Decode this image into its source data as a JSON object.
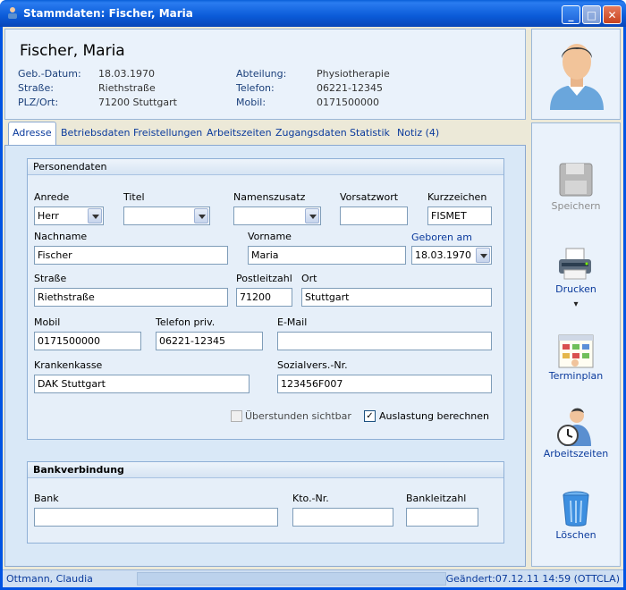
{
  "window": {
    "title": "Stammdaten: Fischer, Maria"
  },
  "header": {
    "name": "Fischer, Maria",
    "fields": [
      {
        "label": "Geb.-Datum:",
        "value": "18.03.1970"
      },
      {
        "label": "Straße:",
        "value": "Riethstraße"
      },
      {
        "label": "PLZ/Ort:",
        "value": "71200 Stuttgart"
      },
      {
        "label": "Abteilung:",
        "value": "Physiotherapie"
      },
      {
        "label": "Telefon:",
        "value": "06221-12345"
      },
      {
        "label": "Mobil:",
        "value": "0171500000"
      }
    ]
  },
  "tabs": [
    "Adresse",
    "Betriebsdaten",
    "Freistellungen",
    "Arbeitszeiten",
    "Zugangsdaten",
    "Statistik",
    "Notiz (4)"
  ],
  "personendaten": {
    "title": "Personendaten",
    "anrede": {
      "label": "Anrede",
      "value": "Herr"
    },
    "titel": {
      "label": "Titel",
      "value": ""
    },
    "namenszusatz": {
      "label": "Namenszusatz",
      "value": ""
    },
    "vorsatzwort": {
      "label": "Vorsatzwort",
      "value": ""
    },
    "kurzzeichen": {
      "label": "Kurzzeichen",
      "value": "FISMET"
    },
    "nachname": {
      "label": "Nachname",
      "value": "Fischer"
    },
    "vorname": {
      "label": "Vorname",
      "value": "Maria"
    },
    "geboren": {
      "label": "Geboren am",
      "value": "18.03.1970"
    },
    "strasse": {
      "label": "Straße",
      "value": "Riethstraße"
    },
    "plz": {
      "label": "Postleitzahl",
      "value": "71200"
    },
    "ort": {
      "label": "Ort",
      "value": "Stuttgart"
    },
    "mobil": {
      "label": "Mobil",
      "value": "0171500000"
    },
    "telefon": {
      "label": "Telefon priv.",
      "value": "06221-12345"
    },
    "email": {
      "label": "E-Mail",
      "value": ""
    },
    "krankenkasse": {
      "label": "Krankenkasse",
      "value": "DAK Stuttgart"
    },
    "sozial": {
      "label": "Sozialvers.-Nr.",
      "value": "123456F007"
    },
    "ueberstunden": {
      "label": "Überstunden sichtbar",
      "checked": false
    },
    "auslastung": {
      "label": "Auslastung berechnen",
      "checked": true,
      "mark": "✓"
    }
  },
  "bank": {
    "title": "Bankverbindung",
    "bank": {
      "label": "Bank",
      "value": ""
    },
    "kto": {
      "label": "Kto.-Nr.",
      "value": ""
    },
    "blz": {
      "label": "Bankleitzahl",
      "value": ""
    }
  },
  "sidebar": {
    "speichern": "Speichern",
    "drucken": "Drucken",
    "drucken_arrow": "▾",
    "terminplan": "Terminplan",
    "arbeitszeiten": "Arbeitszeiten",
    "loeschen": "Löschen"
  },
  "status": {
    "user": "Ottmann, Claudia",
    "changed": "Geändert:07.12.11 14:59 (OTTCLA)"
  },
  "colors": {
    "accent": "#0a3a9c",
    "titlebar": "#0b5bd8",
    "panel": "#eaf2fb"
  }
}
